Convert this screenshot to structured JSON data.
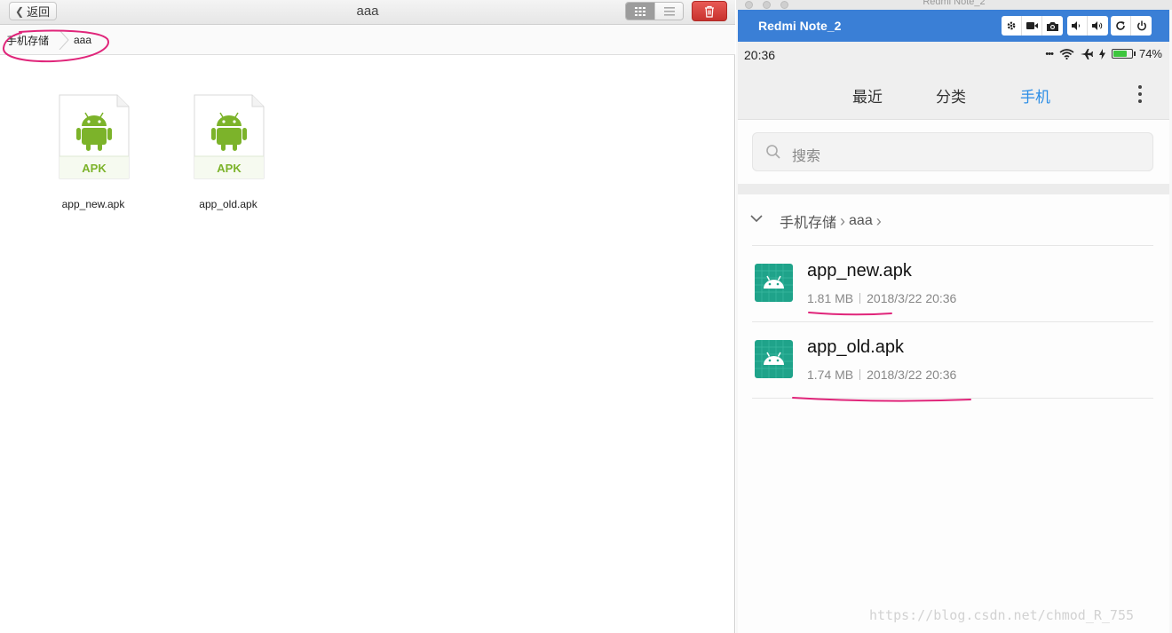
{
  "desktop": {
    "back_label": "返回",
    "window_title": "aaa",
    "breadcrumb": [
      "手机存储",
      "aaa"
    ],
    "files": [
      {
        "name": "app_new.apk",
        "badge": "APK"
      },
      {
        "name": "app_old.apk",
        "badge": "APK"
      }
    ]
  },
  "phone": {
    "window_title": "Redmi Note_2",
    "device_name": "Redmi Note_2",
    "status": {
      "time": "20:36",
      "dots": "•••",
      "battery": "74%",
      "battery_level": 0.74
    },
    "tabs": [
      "最近",
      "分类",
      "手机"
    ],
    "active_tab": "手机",
    "search_placeholder": "搜索",
    "path": [
      "手机存储",
      "aaa"
    ],
    "files": [
      {
        "name": "app_new.apk",
        "size": "1.81 MB",
        "date": "2018/3/22 20:36"
      },
      {
        "name": "app_old.apk",
        "size": "1.74 MB",
        "date": "2018/3/22 20:36"
      }
    ],
    "accent_color": "#3a7fd6",
    "active_tab_color": "#2c8ee6",
    "apk_icon_color": "#1fa38a"
  },
  "annotation_color": "#e0257a",
  "android_green": "#7cb32a",
  "watermark": "https://blog.csdn.net/chmod_R_755"
}
